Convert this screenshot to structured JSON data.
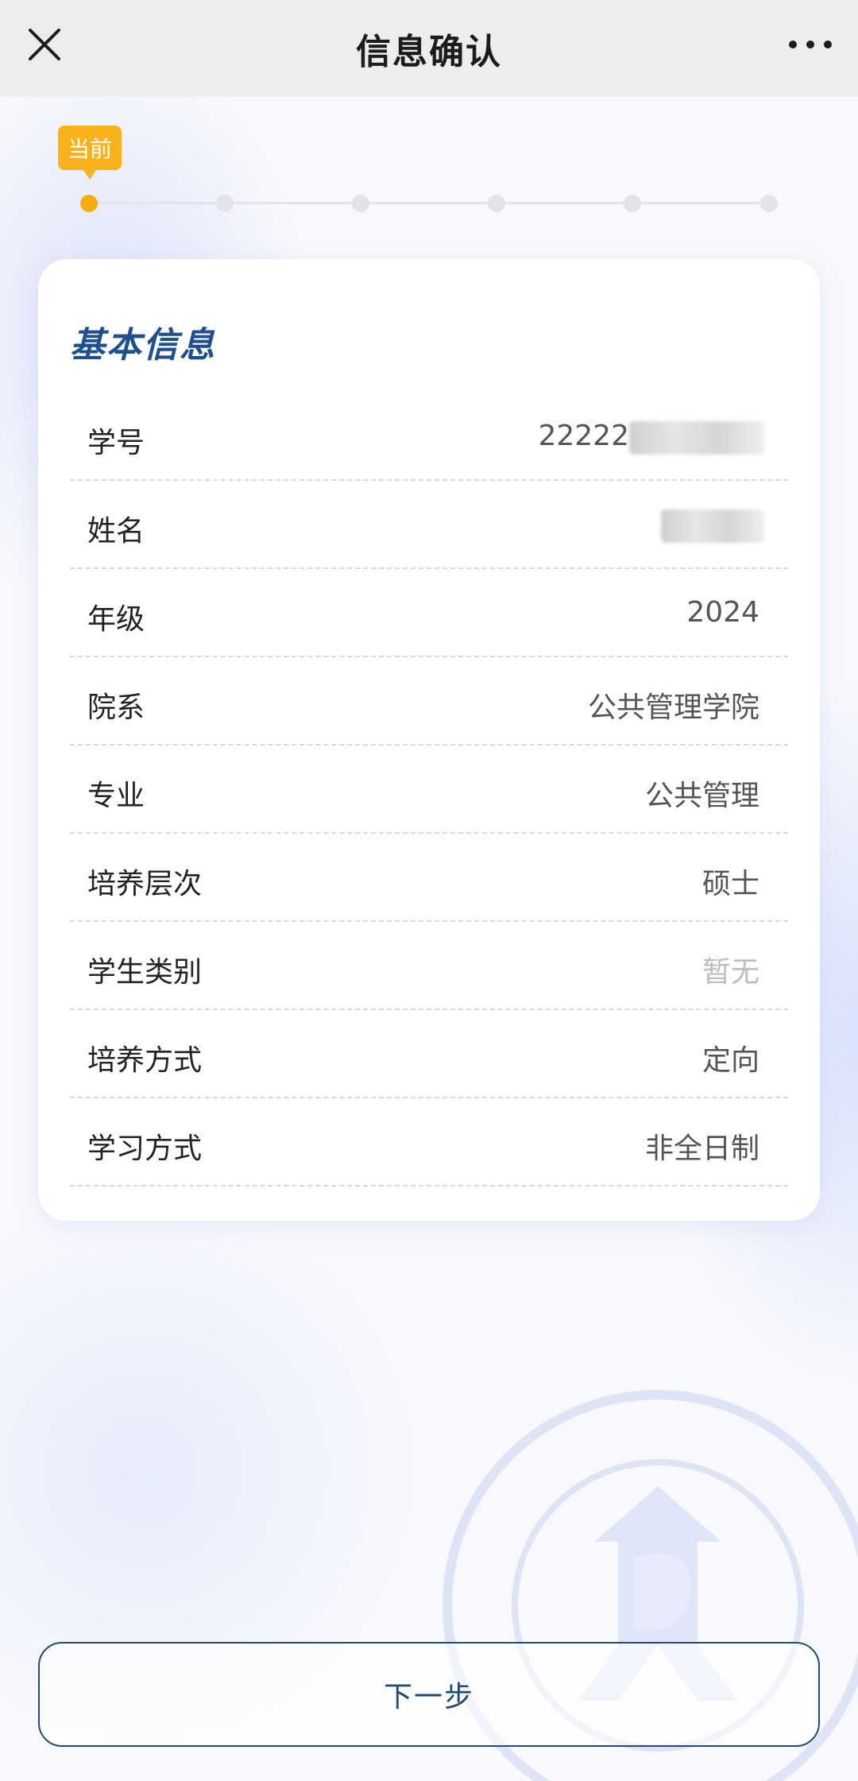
{
  "nav": {
    "title": "信息确认"
  },
  "stepper": {
    "current_badge": "当前",
    "total_steps": 6,
    "current_step": 1
  },
  "card": {
    "title": "基本信息",
    "rows": [
      {
        "label": "学号",
        "value": "22222",
        "redacted": true
      },
      {
        "label": "姓名",
        "value": "",
        "redacted": true
      },
      {
        "label": "年级",
        "value": "2024"
      },
      {
        "label": "院系",
        "value": "公共管理学院"
      },
      {
        "label": "专业",
        "value": "公共管理"
      },
      {
        "label": "培养层次",
        "value": "硕士"
      },
      {
        "label": "学生类别",
        "value": "暂无",
        "muted": true
      },
      {
        "label": "培养方式",
        "value": "定向"
      },
      {
        "label": "学习方式",
        "value": "非全日制"
      }
    ]
  },
  "footer": {
    "next_label": "下一步"
  },
  "colors": {
    "accent": "#f5ae12",
    "title_blue": "#1f4f8c",
    "button_border": "#244a72"
  }
}
